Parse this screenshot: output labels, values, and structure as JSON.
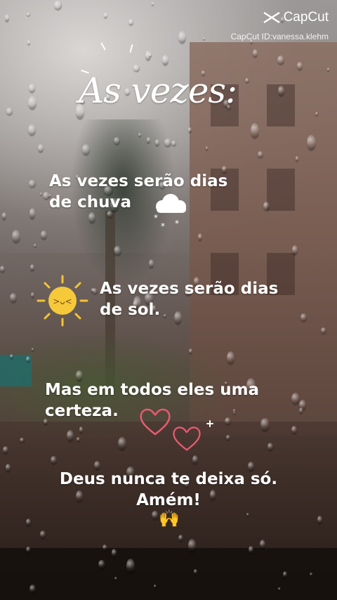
{
  "watermark": {
    "brand": "CapCut",
    "id_text": "CapCut ID:vanessa.klehm"
  },
  "title": "As vezes:",
  "lines": {
    "rain_1": "As vezes serão dias",
    "rain_2": "de chuva",
    "sun_1": "As vezes serão dias",
    "sun_2": "de sol.",
    "certainty_1": "Mas em todos eles uma",
    "certainty_2": "certeza.",
    "god_1": "Deus nunca te deixa só.",
    "god_2": "Amém!",
    "praise": "🙌"
  },
  "colors": {
    "text": "#ffffff",
    "sun": "#f4c431",
    "heart": "#e85a72"
  },
  "icons": [
    "capcut-logo-icon",
    "cloud-icon",
    "sun-icon",
    "heart-icon",
    "sparkle-icon"
  ]
}
